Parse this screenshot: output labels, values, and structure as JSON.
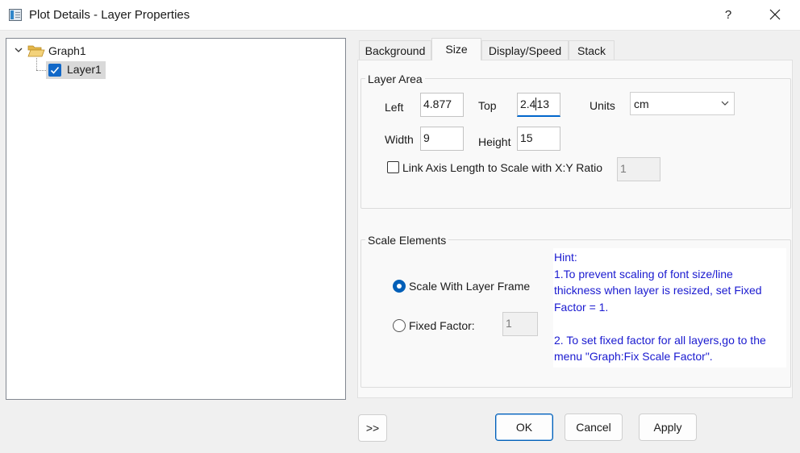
{
  "window": {
    "title": "Plot Details - Layer Properties",
    "help_label": "?"
  },
  "tree": {
    "graph_label": "Graph1",
    "layer_label": "Layer1",
    "layer_checked": true
  },
  "tabs": [
    {
      "label": "Background",
      "active": false
    },
    {
      "label": "Size",
      "active": true
    },
    {
      "label": "Display/Speed",
      "active": false
    },
    {
      "label": "Stack",
      "active": false
    }
  ],
  "layer_area": {
    "group_label": "Layer Area",
    "left_label": "Left",
    "left_value": "4.877",
    "top_label": "Top",
    "top_value_before_caret": "2.4",
    "top_value_after_caret": "13",
    "units_label": "Units",
    "units_value": "cm",
    "width_label": "Width",
    "width_value": "9",
    "height_label": "Height",
    "height_value": "15",
    "link_label": "Link Axis Length to Scale with X:Y Ratio",
    "link_checked": false,
    "ratio_value": "1"
  },
  "scale_elements": {
    "group_label": "Scale Elements",
    "option_frame_label": "Scale With Layer Frame",
    "option_frame_selected": true,
    "option_fixed_label": "Fixed Factor:",
    "fixed_factor_value": "1",
    "hint_lines": [
      "Hint:",
      "1.To prevent scaling of font size/line",
      "thickness when layer is resized, set Fixed",
      "Factor = 1.",
      "",
      "2. To set fixed factor for all layers,go to the",
      "menu \"Graph:Fix Scale Factor\"."
    ]
  },
  "buttons": {
    "expand_label": ">>",
    "ok_label": "OK",
    "cancel_label": "Cancel",
    "apply_label": "Apply"
  },
  "colors": {
    "accent": "#005fb8",
    "check_fill": "#1168c8",
    "hint_text": "#1a1ad0",
    "selection": "#d9d9d9"
  }
}
